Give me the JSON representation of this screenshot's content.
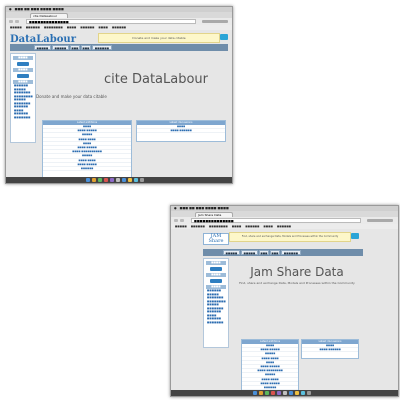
{
  "screenshot_a": {
    "tab_title": "cite DataLabour",
    "logo": "DataLabour",
    "notice": "Donate and make your data citable",
    "hero_title": "cite DataLabour",
    "hero_subtitle": "Donate and make your data citable",
    "panel_left_title": "Latest additions",
    "panel_right_title": "Latest discussions"
  },
  "screenshot_b": {
    "tab_title": "Jam Share Data",
    "logo": "JAM Share",
    "notice": "Find, share and exchange Data, Models and Processes within the Community",
    "hero_title": "Jam Share Data",
    "hero_subtitle": "Find, share and exchange Data, Models and Processes within the Community",
    "panel_left_title": "Latest additions",
    "panel_right_title": "Latest discussions"
  },
  "colors": {
    "accent": "#2aa4d6",
    "nav_bar": "#6f8daa",
    "panel_header": "#7ea6cf",
    "notice_bg": "#fdf7c9"
  }
}
